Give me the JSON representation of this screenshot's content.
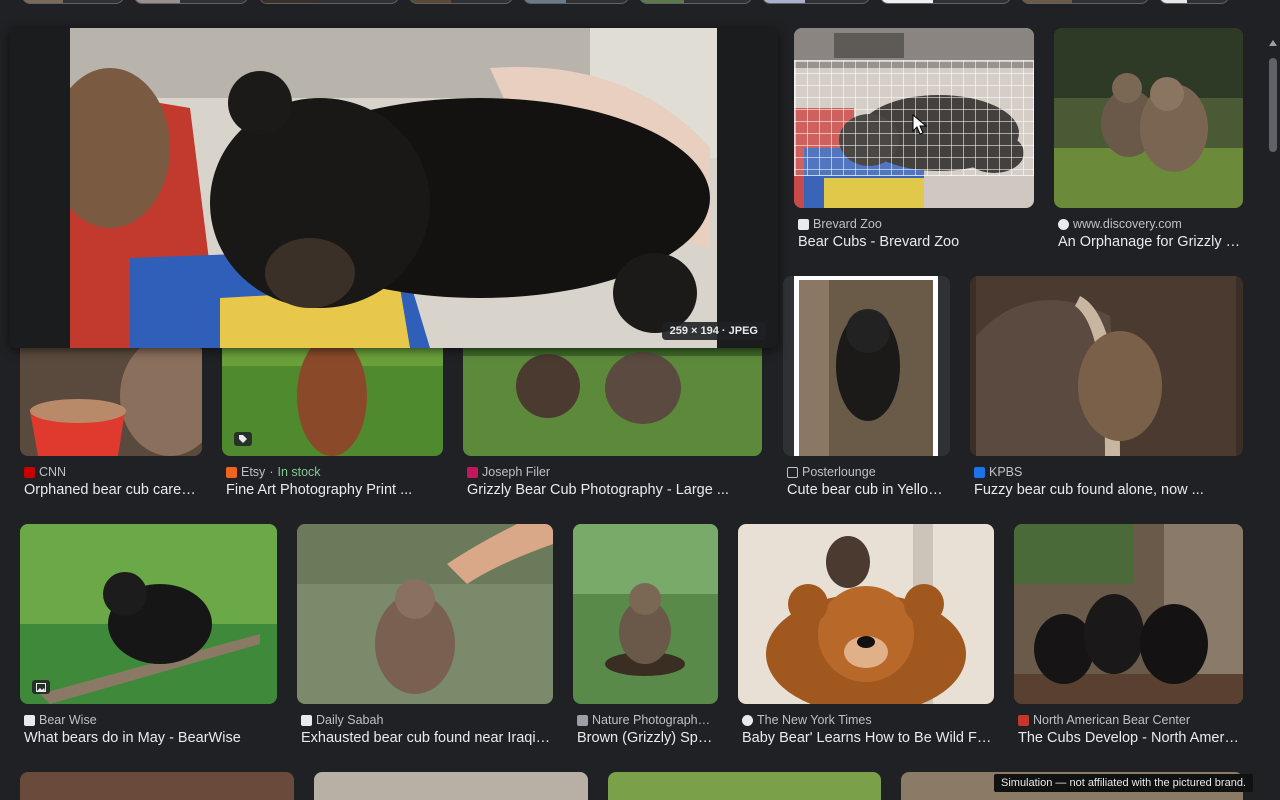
{
  "preview": {
    "dimensions": "259 × 194 · JPEG"
  },
  "cards": [
    {
      "source": "Brevard Zoo",
      "title": "Bear Cubs - Brevard Zoo"
    },
    {
      "source": "www.discovery.com",
      "title": "An Orphanage for Grizzly Bear Cubs"
    },
    {
      "source": "CNN",
      "title": "Orphaned bear cub care for cubs"
    },
    {
      "source": "Etsy",
      "stock_sep": " · ",
      "stock": "In stock",
      "title": "Fine Art Photography Print ..."
    },
    {
      "source": "Joseph Filer",
      "title": "Grizzly Bear Cub Photography - Large ..."
    },
    {
      "source": "Posterlounge",
      "title": "Cute bear cub in Yellowstone"
    },
    {
      "source": "KPBS",
      "title": "Fuzzy bear cub found alone, now ..."
    },
    {
      "source": "Bear Wise",
      "title": "What bears do in May - BearWise"
    },
    {
      "source": "Daily Sabah",
      "title": "Exhausted bear cub found near Iraqi border"
    },
    {
      "source": "Nature Photographers",
      "title": "Brown (Grizzly) Species"
    },
    {
      "source": "The New York Times",
      "title": "Baby Bear' Learns How to Be Wild Fast"
    },
    {
      "source": "North American Bear Center",
      "title": "The Cubs Develop - North American Bear Center"
    }
  ],
  "disclaimer": "Simulation — not affiliated with the pictured brand.",
  "colors": {
    "background": "#202124",
    "stock": "#81c995",
    "secondary_text": "#bdc1c6"
  }
}
